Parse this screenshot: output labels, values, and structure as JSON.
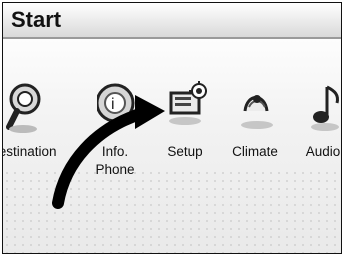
{
  "header": {
    "title": "Start"
  },
  "menu": {
    "items": [
      {
        "label": "Destination",
        "icon": "destination-icon"
      },
      {
        "label": "Info.",
        "label2": "Phone",
        "icon": "info-phone-icon"
      },
      {
        "label": "Setup",
        "icon": "setup-icon"
      },
      {
        "label": "Climate",
        "icon": "climate-icon"
      },
      {
        "label": "Audio",
        "icon": "audio-icon"
      }
    ]
  },
  "annotation": {
    "arrow": "curved-pointer-arrow-icon"
  }
}
